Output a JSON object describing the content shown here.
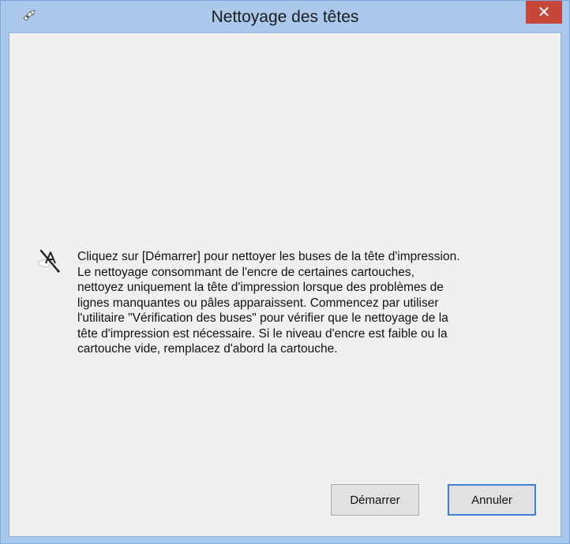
{
  "window": {
    "title": "Nettoyage des têtes",
    "close_glyph": "✕",
    "title_icon": "printer-head-icon"
  },
  "content": {
    "icon": "printer-head-icon",
    "message": "Cliquez sur [Démarrer] pour nettoyer les buses de la tête d'impression.\nLe nettoyage consommant de l'encre de certaines cartouches,\nnettoyez uniquement la tête d'impression lorsque des problèmes de\nlignes manquantes ou pâles apparaissent. Commencez par utiliser\nl'utilitaire \"Vérification des buses\" pour vérifier que le nettoyage de la\ntête d'impression est nécessaire. Si le niveau d'encre est faible ou la\ncartouche vide, remplacez d'abord la cartouche."
  },
  "buttons": {
    "start_label": "Démarrer",
    "cancel_label": "Annuler"
  },
  "colors": {
    "titlebar": "#a9c8ec",
    "close_button": "#c7463a",
    "client_background": "#f0f0f0",
    "focus_border": "#3c7fd8"
  }
}
